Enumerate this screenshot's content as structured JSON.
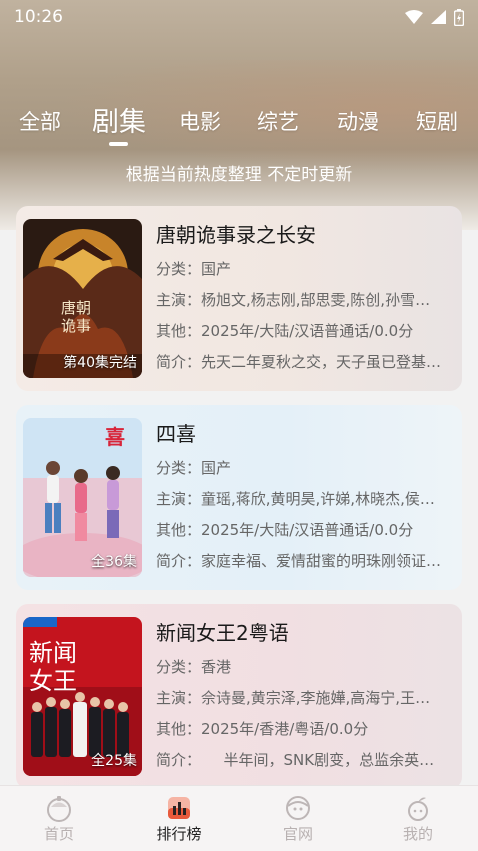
{
  "status_bar": {
    "time": "10:26"
  },
  "tabs": [
    {
      "label": "全部"
    },
    {
      "label": "剧集"
    },
    {
      "label": "电影"
    },
    {
      "label": "综艺"
    },
    {
      "label": "动漫"
    },
    {
      "label": "短剧"
    }
  ],
  "active_tab": "剧集",
  "subtitle": "根据当前热度整理 不定时更新",
  "items": [
    {
      "title": "唐朝诡事录之长安",
      "category": "分类：国产",
      "cast": "主演：杨旭文,杨志刚,郜思雯,陈创,孙雪…",
      "other": "其他：2025年/大陆/汉语普通话/0.0分",
      "summary": "简介：先天二年夏秋之交，天子虽已登基…",
      "badge": "第40集完结",
      "poster_text": "唐朝诡事"
    },
    {
      "title": "四喜",
      "category": "分类：国产",
      "cast": "主演：童瑶,蒋欣,黄明昊,许娣,林晓杰,侯…",
      "other": "其他：2025年/大陆/汉语普通话/0.0分",
      "summary": "简介：家庭幸福、爱情甜蜜的明珠刚领证…",
      "badge": "全36集",
      "poster_text": "喜"
    },
    {
      "title": "新闻女王2粤语",
      "category": "分类：香港",
      "cast": "主演：佘诗曼,黄宗泽,李施嬅,高海宁,王…",
      "other": "其他：2025年/香港/粤语/0.0分",
      "summary": "简介：　　半年间，SNK剧变，总监余英…",
      "badge": "全25集",
      "poster_text": "新闻女王"
    }
  ],
  "bottom_nav": [
    {
      "label": "首页",
      "icon": "home-icon"
    },
    {
      "label": "排行榜",
      "icon": "ranking-icon"
    },
    {
      "label": "官网",
      "icon": "website-icon"
    },
    {
      "label": "我的",
      "icon": "profile-icon"
    }
  ],
  "active_nav": "排行榜"
}
